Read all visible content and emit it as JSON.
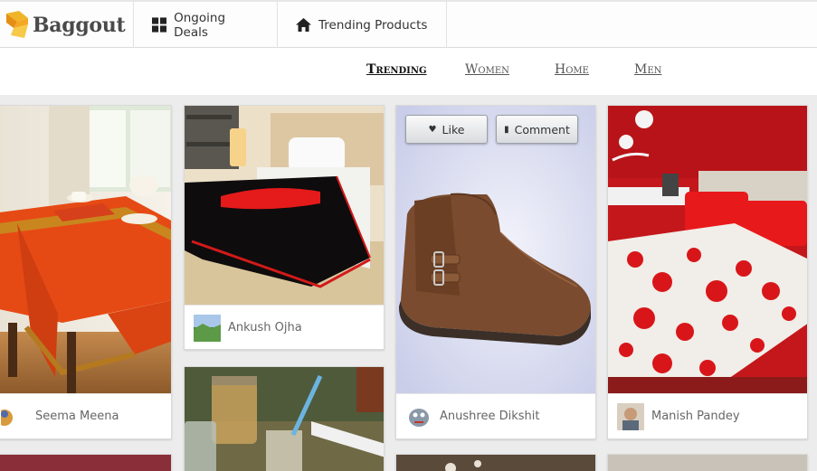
{
  "brand": {
    "name": "Baggout"
  },
  "topnav": [
    {
      "label": "Ongoing Deals",
      "icon": "grid-icon"
    },
    {
      "label": "Trending Products",
      "icon": "home-icon"
    }
  ],
  "subnav": [
    {
      "label": "Trending",
      "active": true
    },
    {
      "label": "Women",
      "active": false
    },
    {
      "label": "Home",
      "active": false
    },
    {
      "label": "Men",
      "active": false
    }
  ],
  "cards": [
    {
      "owner": "Seema Meena",
      "image": "orange-table-cloth"
    },
    {
      "owner": "Ankush Ojha",
      "image": "black-red-blanket"
    },
    {
      "owner": "Anushree Dikshit",
      "image": "brown-leather-boot"
    },
    {
      "owner": "Manish Pandey",
      "image": "red-floral-bedsheet"
    },
    {
      "owner": "",
      "image": "jars-still-life"
    }
  ],
  "actions": {
    "like": "Like",
    "comment": "Comment"
  },
  "colors": {
    "accent": "#e3a21a",
    "background": "#ececec"
  }
}
